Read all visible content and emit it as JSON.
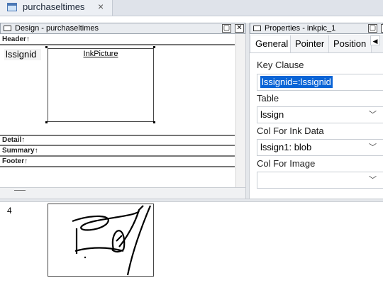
{
  "tab": {
    "title": "purchaseltimes",
    "close": "×"
  },
  "design": {
    "title": "Design - purchaseltimes",
    "bands": {
      "header": "Header↑",
      "detail": "Detail↑",
      "summary": "Summary↑",
      "footer": "Footer↑"
    },
    "column_label": "lssignid",
    "ink_picture_label": "InkPicture"
  },
  "properties": {
    "title": "Properties - inkpic_1",
    "tabs": [
      "General",
      "Pointer",
      "Position"
    ],
    "fields": [
      {
        "label": "Key Clause",
        "value": "lssignid=:lssignid"
      },
      {
        "label": "Table",
        "value": "lssign"
      },
      {
        "label": "Col For Ink Data",
        "value": "lssign1: blob"
      },
      {
        "label": "Col For Image",
        "value": ""
      }
    ]
  },
  "preview": {
    "row_value": "4"
  }
}
